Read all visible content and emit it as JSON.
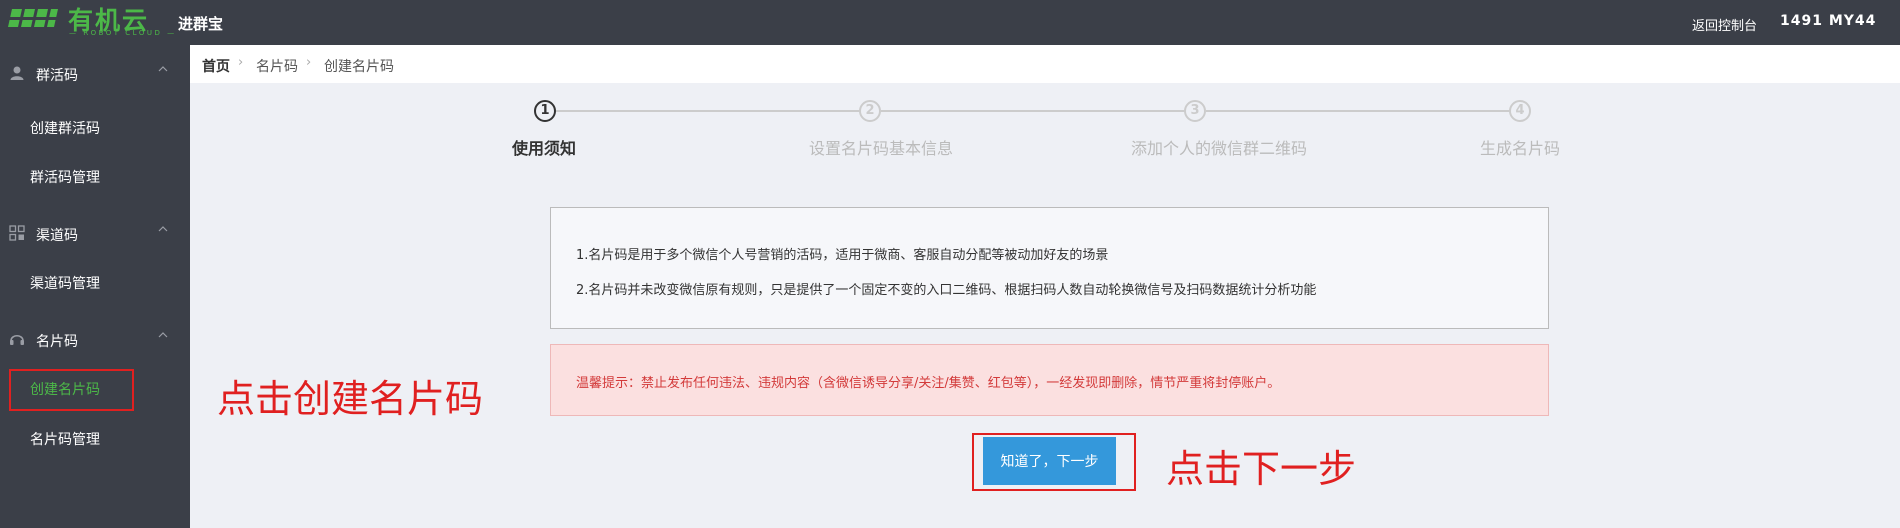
{
  "topbar": {
    "logo_text": "有机云",
    "logo_subtext": "— ROBOT CLOUD —",
    "app_name": "进群宝",
    "back_link": "返回控制台",
    "user_name": "1491 MY44"
  },
  "sidebar": {
    "groups": [
      {
        "label": "群活码",
        "icon": "user-icon",
        "items": [
          "创建群活码",
          "群活码管理"
        ]
      },
      {
        "label": "渠道码",
        "icon": "grid-icon",
        "items": [
          "渠道码管理"
        ]
      },
      {
        "label": "名片码",
        "icon": "headset-icon",
        "items": [
          "创建名片码",
          "名片码管理"
        ]
      }
    ],
    "active_item": "创建名片码",
    "active_color": "#4cb848"
  },
  "breadcrumb": [
    "首页",
    "名片码",
    "创建名片码"
  ],
  "steps": [
    {
      "number": "1",
      "label": "使用须知",
      "active": true
    },
    {
      "number": "2",
      "label": "设置名片码基本信息",
      "active": false
    },
    {
      "number": "3",
      "label": "添加个人的微信群二维码",
      "active": false
    },
    {
      "number": "4",
      "label": "生成名片码",
      "active": false
    }
  ],
  "notice": {
    "line1": "1.名片码是用于多个微信个人号营销的活码，适用于微商、客服自动分配等被动加好友的场景",
    "line2": "2.名片码并未改变微信原有规则，只是提供了一个固定不变的入口二维码、根据扫码人数自动轮换微信号及扫码数据统计分析功能"
  },
  "warning": {
    "text": "温馨提示：禁止发布任何违法、违规内容（含微信诱导分享/关注/集赞、红包等），一经发现即删除，情节严重将封停账户。"
  },
  "next_button": {
    "label": "知道了，下一步",
    "color": "#3498db"
  },
  "annotations": {
    "left_text": "点击创建名片码",
    "right_text": "点击下一步",
    "color": "#e02020"
  }
}
